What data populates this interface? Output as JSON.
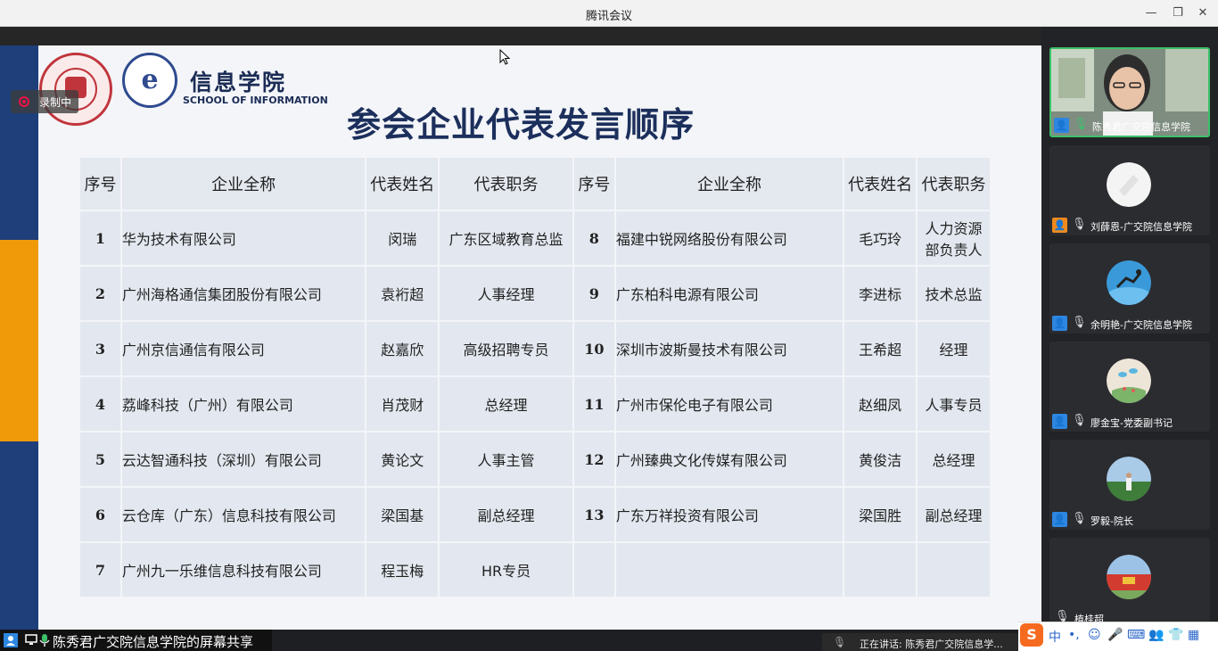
{
  "window": {
    "title": "腾讯会议"
  },
  "controls": {
    "minimize": "—",
    "restore": "❐",
    "close": "✕"
  },
  "recording": {
    "label": "录制中"
  },
  "slide": {
    "school_cn": "信息学院",
    "school_en": "SCHOOL OF INFORMATION",
    "logo2_letter": "e",
    "title": "参会企业代表发言顺序",
    "headers": [
      "序号",
      "企业全称",
      "代表姓名",
      "代表职务",
      "序号",
      "企业全称",
      "代表姓名",
      "代表职务"
    ],
    "rows": [
      {
        "no": "1",
        "company": "华为技术有限公司",
        "name": "闵瑞",
        "title": "广东区域教育总监",
        "no2": "8",
        "company2": "福建中锐网络股份有限公司",
        "name2": "毛巧玲",
        "title2a": "人力资源",
        "title2b": "部负责人"
      },
      {
        "no": "2",
        "company": "广州海格通信集团股份有限公司",
        "name": "袁裄超",
        "title": "人事经理",
        "no2": "9",
        "company2": "广东柏科电源有限公司",
        "name2": "李进标",
        "title2a": "技术总监",
        "title2b": ""
      },
      {
        "no": "3",
        "company": "广州京信通信有限公司",
        "name": "赵嘉欣",
        "title": "高级招聘专员",
        "no2": "10",
        "company2": "深圳市波斯曼技术有限公司",
        "name2": "王希超",
        "title2a": "经理",
        "title2b": ""
      },
      {
        "no": "4",
        "company": "荔峰科技（广州）有限公司",
        "name": "肖茂财",
        "title": "总经理",
        "no2": "11",
        "company2": "广州市保伦电子有限公司",
        "name2": "赵细凤",
        "title2a": "人事专员",
        "title2b": ""
      },
      {
        "no": "5",
        "company": "云达智通科技（深圳）有限公司",
        "name": "黄论文",
        "title": "人事主管",
        "no2": "12",
        "company2": "广州臻典文化传媒有限公司",
        "name2": "黄俊洁",
        "title2a": "总经理",
        "title2b": ""
      },
      {
        "no": "6",
        "company": "云仓库（广东）信息科技有限公司",
        "name": "梁国基",
        "title": "副总经理",
        "no2": "13",
        "company2": "广东万祥投资有限公司",
        "name2": "梁国胜",
        "title2a": "副总经理",
        "title2b": ""
      },
      {
        "no": "7",
        "company": "广州九一乐维信息科技有限公司",
        "name": "程玉梅",
        "title": "HR专员",
        "no2": "",
        "company2": "",
        "name2": "",
        "title2a": "",
        "title2b": ""
      }
    ]
  },
  "share_bar": {
    "text": "陈秀君广交院信息学院的屏幕共享"
  },
  "speaking": {
    "text": "正在讲话: 陈秀君广交院信息学..."
  },
  "participants": [
    {
      "name": "陈秀君广交院信息学院",
      "active": true,
      "mic": "on",
      "icon_color": "#2d86e0"
    },
    {
      "name": "刘薛恩-广交院信息学院",
      "active": false,
      "mic": "off",
      "icon_color": "#f08a1d"
    },
    {
      "name": "余明艳-广交院信息学院",
      "active": false,
      "mic": "off",
      "icon_color": "#2d86e0"
    },
    {
      "name": "廖金宝-党委副书记",
      "active": false,
      "mic": "off",
      "icon_color": "#2d86e0"
    },
    {
      "name": "罗毅-院长",
      "active": false,
      "mic": "off",
      "icon_color": "#2d86e0"
    },
    {
      "name": "植桂超",
      "active": false,
      "mic": "off",
      "icon_color": ""
    }
  ],
  "ime": {
    "logo": "S",
    "mode": "中",
    "punct": "•,",
    "keyboard": "⌨"
  }
}
